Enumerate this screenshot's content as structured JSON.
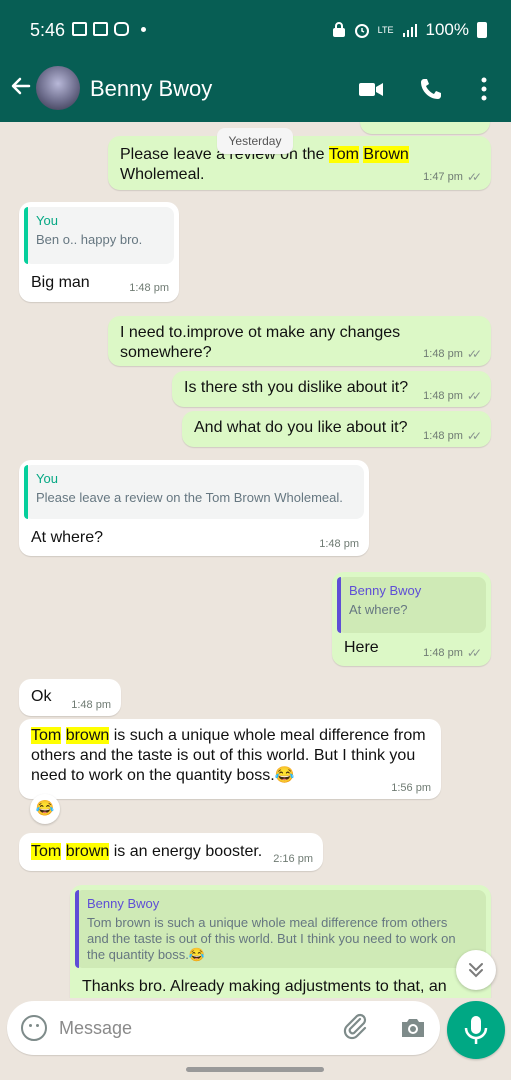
{
  "status_bar": {
    "time": "5:46",
    "network": "LTE",
    "battery": "100%"
  },
  "header": {
    "contact_name": "Benny Bwoy",
    "icons": [
      "back-arrow-icon",
      "video-call-icon",
      "phone-icon",
      "more-options-icon"
    ],
    "color": "#075e54"
  },
  "chat": {
    "date_chip": "Yesterday",
    "messages": [
      {
        "dir": "out",
        "text_before": "Please leave a review on the ",
        "highlight1": "Tom",
        "highlight2": "Brown",
        "text_after": " Wholemeal.",
        "time": "1:47 pm"
      },
      {
        "dir": "in",
        "quote_name": "You",
        "quote_text": "Ben o.. happy bro.",
        "text": "Big man",
        "time": "1:48 pm"
      },
      {
        "dir": "out",
        "text": "I need to.improve ot make any changes somewhere?",
        "time": "1:48 pm"
      },
      {
        "dir": "out",
        "text": "Is there sth you dislike about it?",
        "time": "1:48 pm"
      },
      {
        "dir": "out",
        "text": "And what do you like about it?",
        "time": "1:48 pm"
      },
      {
        "dir": "in",
        "quote_name": "You",
        "quote_text": "Please leave a review on the Tom Brown Wholemeal.",
        "text": "At where?",
        "time": "1:48 pm"
      },
      {
        "dir": "out",
        "quote_name": "Benny Bwoy",
        "quote_text": "At where?",
        "text": "Here",
        "time": "1:48 pm"
      },
      {
        "dir": "in",
        "text": "Ok",
        "time": "1:48 pm"
      },
      {
        "dir": "in",
        "highlight1": "Tom",
        "highlight2": "brown",
        "line1_rest": " is such a unique whole meal difference from",
        "line2": "others and the taste is out of this world. But I think you",
        "line3": "need to work on the quantity boss.😂",
        "time": "1:56 pm",
        "reaction": "😂"
      },
      {
        "dir": "in",
        "highlight1": "Tom",
        "highlight2": "brown",
        "text_after": " is an energy booster.",
        "time": "2:16 pm"
      },
      {
        "dir": "out",
        "quote_name": "Benny Bwoy",
        "quote_line1": "Tom brown is such a unique whole meal difference from others",
        "quote_line2": "and the taste is out of this world. But I think you need to work on",
        "quote_line3": "the quantity boss.😂",
        "text": "Thanks bro. Already making adjustments to that, an"
      }
    ]
  },
  "composer": {
    "placeholder": "Message",
    "icons": [
      "emoji-icon",
      "attach-icon",
      "camera-icon",
      "mic-icon"
    ]
  },
  "colors": {
    "outgoing_bubble": "#dcf8c6",
    "incoming_bubble": "#ffffff",
    "accent": "#00a884",
    "highlight": "#ffff00"
  }
}
